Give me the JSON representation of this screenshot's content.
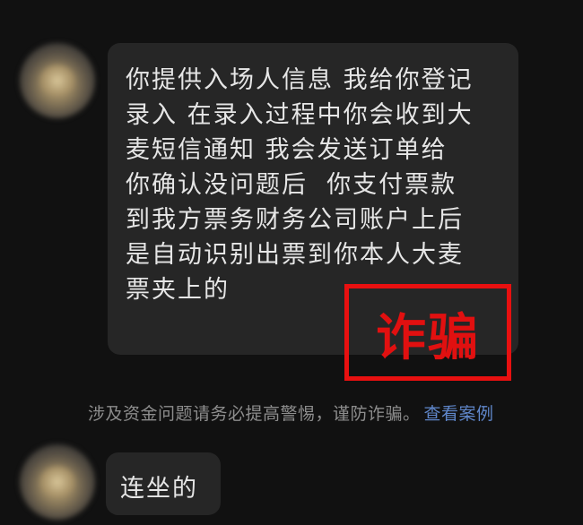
{
  "message1": {
    "lines": [
      "你提供入场人信息 我给你登记",
      "录入 在录入过程中你会收到大",
      "麦短信通知 我会发送订单给",
      "你确认没问题后  你支付票款",
      "到我方票务财务公司账户上后",
      "是自动识别出票到你本人大麦",
      "票夹上的"
    ]
  },
  "stamp": {
    "label": "诈骗",
    "color": "#e11010"
  },
  "warning": {
    "text": "涉及资金问题请务必提高警惕，谨防诈骗。",
    "link": "查看案例"
  },
  "message2": {
    "text": "连坐的"
  },
  "colors": {
    "background": "#111111",
    "bubble": "#262626",
    "link": "#5f86c9"
  }
}
